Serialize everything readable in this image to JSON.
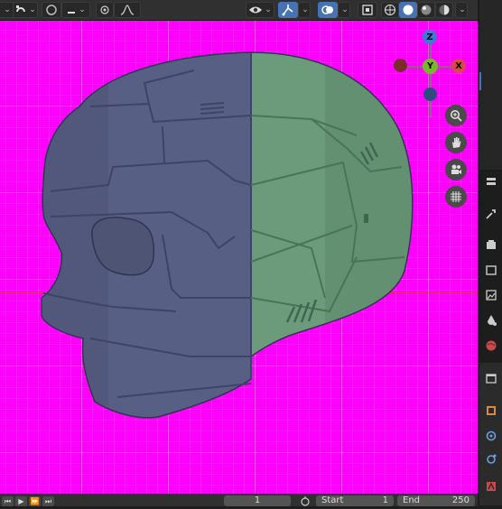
{
  "header": {
    "icons": [
      "transform-icon",
      "pivot-icon",
      "snap-icon",
      "proportional-icon",
      "falloff-icon",
      "visibility-icon",
      "gizmo-icon",
      "overlay-icon",
      "xray-icon",
      "wireframe-icon",
      "solid-icon",
      "material-icon",
      "rendered-icon"
    ],
    "active": [
      "gizmo-icon",
      "overlay-icon",
      "solid-icon"
    ]
  },
  "viewport": {
    "background_color": "#ff00ff",
    "gizmo": {
      "z_label": "Z",
      "y_label": "Y",
      "x_label": "X"
    },
    "nav_buttons": [
      "zoom-icon",
      "hand-pan-icon",
      "camera-icon",
      "grid-ortho-icon"
    ],
    "model_colors": {
      "left_half": "#585f85",
      "right_half": "#6c9b7c"
    }
  },
  "right_strip": {
    "icons": [
      "tool-icon",
      "render-icon",
      "output-icon",
      "view-layer-icon",
      "scene-icon",
      "world-icon",
      "collection-icon",
      "object-icon",
      "modifier-icon",
      "particles-icon",
      "physics-icon"
    ]
  },
  "footer": {
    "current_frame": "1",
    "start_label": "Start",
    "start_value": "1",
    "end_label": "End",
    "end_value": "250"
  }
}
